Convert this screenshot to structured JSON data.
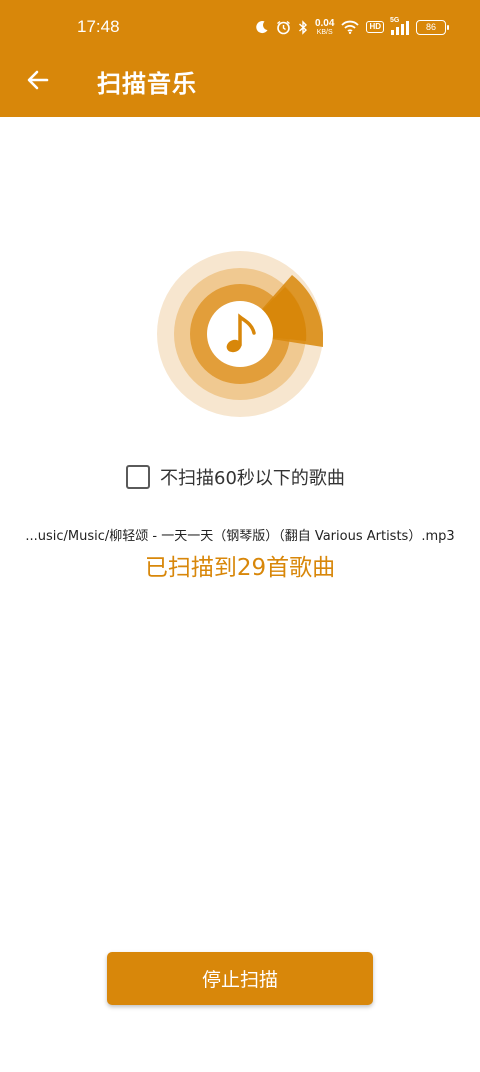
{
  "status_bar": {
    "time": "17:48",
    "net_speed_value": "0.04",
    "net_speed_unit": "KB/S",
    "hd_label": "HD",
    "network_gen": "5G",
    "battery_level": "86",
    "icons": [
      "moon-icon",
      "alarm-icon",
      "bluetooth-icon",
      "wifi-icon",
      "signal-icon",
      "battery-icon"
    ]
  },
  "header": {
    "title": "扫描音乐",
    "back_icon": "arrow-left-icon"
  },
  "scan": {
    "icon": "music-note-icon",
    "skip_short_label": "不扫描60秒以下的歌曲",
    "skip_short_checked": false,
    "current_file": "...usic/Music/柳轻颂 - 一天一天（钢琴版）（翻自 Various Artists）.mp3",
    "count_text": "已扫描到29首歌曲"
  },
  "actions": {
    "stop_label": "停止扫描"
  },
  "colors": {
    "accent": "#D8870A",
    "ring_outer": "#F7E6CF",
    "ring_mid": "#F0C991",
    "ring_inner": "#E29E3A",
    "white": "#FFFFFF"
  }
}
